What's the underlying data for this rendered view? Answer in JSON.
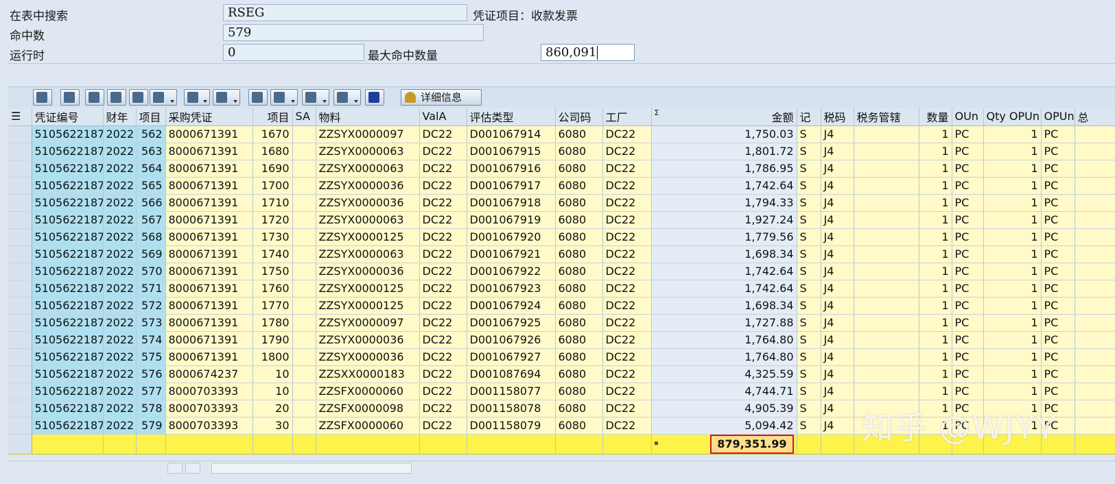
{
  "form": {
    "search_label": "在表中搜索",
    "search_value": "RSEG",
    "search_note": "凭证项目：收款发票",
    "hits_label": "命中数",
    "hits_value": "579",
    "runtime_label": "运行时",
    "runtime_value": "0",
    "max_hits_label": "最大命中数量",
    "max_hits_value": "860,091"
  },
  "toolbar": {
    "detail_label": "详细信息",
    "buttons": [
      "details-icon",
      "print-icon",
      "filter-icon",
      "save-icon",
      "layout-icon",
      "filter-dropdown-icon",
      "sum-icon",
      "subtotal-icon",
      "print-preview-icon",
      "export-icon",
      "spreadsheet-icon",
      "grid-layout-icon",
      "info-icon"
    ]
  },
  "columns": [
    "凭证编号",
    "财年",
    "项目",
    "采购凭证",
    "项目",
    "SA",
    "物料",
    "ValA",
    "评估类型",
    "公司码",
    "工厂",
    "金额",
    "记",
    "税码",
    "税务管辖",
    "数量",
    "OUn",
    "Qty OPUn",
    "OPUn",
    "总"
  ],
  "sum_marker": "Σ",
  "rows": [
    {
      "doc": "5105622187",
      "fy": "2022",
      "item": "562",
      "po": "8000671391",
      "po_item": "1670",
      "mat": "ZZSYX0000097",
      "vala": "DC22",
      "val_type": "D001067914",
      "cc": "6080",
      "plant": "DC22",
      "amt": "1,750.03",
      "dc": "S",
      "tax": "J4",
      "qty": "1",
      "oun": "PC",
      "qty_opun": "1",
      "opun": "PC"
    },
    {
      "doc": "5105622187",
      "fy": "2022",
      "item": "563",
      "po": "8000671391",
      "po_item": "1680",
      "mat": "ZZSYX0000063",
      "vala": "DC22",
      "val_type": "D001067915",
      "cc": "6080",
      "plant": "DC22",
      "amt": "1,801.72",
      "dc": "S",
      "tax": "J4",
      "qty": "1",
      "oun": "PC",
      "qty_opun": "1",
      "opun": "PC"
    },
    {
      "doc": "5105622187",
      "fy": "2022",
      "item": "564",
      "po": "8000671391",
      "po_item": "1690",
      "mat": "ZZSYX0000063",
      "vala": "DC22",
      "val_type": "D001067916",
      "cc": "6080",
      "plant": "DC22",
      "amt": "1,786.95",
      "dc": "S",
      "tax": "J4",
      "qty": "1",
      "oun": "PC",
      "qty_opun": "1",
      "opun": "PC"
    },
    {
      "doc": "5105622187",
      "fy": "2022",
      "item": "565",
      "po": "8000671391",
      "po_item": "1700",
      "mat": "ZZSYX0000036",
      "vala": "DC22",
      "val_type": "D001067917",
      "cc": "6080",
      "plant": "DC22",
      "amt": "1,742.64",
      "dc": "S",
      "tax": "J4",
      "qty": "1",
      "oun": "PC",
      "qty_opun": "1",
      "opun": "PC"
    },
    {
      "doc": "5105622187",
      "fy": "2022",
      "item": "566",
      "po": "8000671391",
      "po_item": "1710",
      "mat": "ZZSYX0000036",
      "vala": "DC22",
      "val_type": "D001067918",
      "cc": "6080",
      "plant": "DC22",
      "amt": "1,794.33",
      "dc": "S",
      "tax": "J4",
      "qty": "1",
      "oun": "PC",
      "qty_opun": "1",
      "opun": "PC"
    },
    {
      "doc": "5105622187",
      "fy": "2022",
      "item": "567",
      "po": "8000671391",
      "po_item": "1720",
      "mat": "ZZSYX0000063",
      "vala": "DC22",
      "val_type": "D001067919",
      "cc": "6080",
      "plant": "DC22",
      "amt": "1,927.24",
      "dc": "S",
      "tax": "J4",
      "qty": "1",
      "oun": "PC",
      "qty_opun": "1",
      "opun": "PC"
    },
    {
      "doc": "5105622187",
      "fy": "2022",
      "item": "568",
      "po": "8000671391",
      "po_item": "1730",
      "mat": "ZZSYX0000125",
      "vala": "DC22",
      "val_type": "D001067920",
      "cc": "6080",
      "plant": "DC22",
      "amt": "1,779.56",
      "dc": "S",
      "tax": "J4",
      "qty": "1",
      "oun": "PC",
      "qty_opun": "1",
      "opun": "PC"
    },
    {
      "doc": "5105622187",
      "fy": "2022",
      "item": "569",
      "po": "8000671391",
      "po_item": "1740",
      "mat": "ZZSYX0000063",
      "vala": "DC22",
      "val_type": "D001067921",
      "cc": "6080",
      "plant": "DC22",
      "amt": "1,698.34",
      "dc": "S",
      "tax": "J4",
      "qty": "1",
      "oun": "PC",
      "qty_opun": "1",
      "opun": "PC"
    },
    {
      "doc": "5105622187",
      "fy": "2022",
      "item": "570",
      "po": "8000671391",
      "po_item": "1750",
      "mat": "ZZSYX0000036",
      "vala": "DC22",
      "val_type": "D001067922",
      "cc": "6080",
      "plant": "DC22",
      "amt": "1,742.64",
      "dc": "S",
      "tax": "J4",
      "qty": "1",
      "oun": "PC",
      "qty_opun": "1",
      "opun": "PC"
    },
    {
      "doc": "5105622187",
      "fy": "2022",
      "item": "571",
      "po": "8000671391",
      "po_item": "1760",
      "mat": "ZZSYX0000125",
      "vala": "DC22",
      "val_type": "D001067923",
      "cc": "6080",
      "plant": "DC22",
      "amt": "1,742.64",
      "dc": "S",
      "tax": "J4",
      "qty": "1",
      "oun": "PC",
      "qty_opun": "1",
      "opun": "PC"
    },
    {
      "doc": "5105622187",
      "fy": "2022",
      "item": "572",
      "po": "8000671391",
      "po_item": "1770",
      "mat": "ZZSYX0000125",
      "vala": "DC22",
      "val_type": "D001067924",
      "cc": "6080",
      "plant": "DC22",
      "amt": "1,698.34",
      "dc": "S",
      "tax": "J4",
      "qty": "1",
      "oun": "PC",
      "qty_opun": "1",
      "opun": "PC"
    },
    {
      "doc": "5105622187",
      "fy": "2022",
      "item": "573",
      "po": "8000671391",
      "po_item": "1780",
      "mat": "ZZSYX0000097",
      "vala": "DC22",
      "val_type": "D001067925",
      "cc": "6080",
      "plant": "DC22",
      "amt": "1,727.88",
      "dc": "S",
      "tax": "J4",
      "qty": "1",
      "oun": "PC",
      "qty_opun": "1",
      "opun": "PC"
    },
    {
      "doc": "5105622187",
      "fy": "2022",
      "item": "574",
      "po": "8000671391",
      "po_item": "1790",
      "mat": "ZZSYX0000036",
      "vala": "DC22",
      "val_type": "D001067926",
      "cc": "6080",
      "plant": "DC22",
      "amt": "1,764.80",
      "dc": "S",
      "tax": "J4",
      "qty": "1",
      "oun": "PC",
      "qty_opun": "1",
      "opun": "PC"
    },
    {
      "doc": "5105622187",
      "fy": "2022",
      "item": "575",
      "po": "8000671391",
      "po_item": "1800",
      "mat": "ZZSYX0000036",
      "vala": "DC22",
      "val_type": "D001067927",
      "cc": "6080",
      "plant": "DC22",
      "amt": "1,764.80",
      "dc": "S",
      "tax": "J4",
      "qty": "1",
      "oun": "PC",
      "qty_opun": "1",
      "opun": "PC"
    },
    {
      "doc": "5105622187",
      "fy": "2022",
      "item": "576",
      "po": "8000674237",
      "po_item": "10",
      "mat": "ZZSXX0000183",
      "vala": "DC22",
      "val_type": "D001087694",
      "cc": "6080",
      "plant": "DC22",
      "amt": "4,325.59",
      "dc": "S",
      "tax": "J4",
      "qty": "1",
      "oun": "PC",
      "qty_opun": "1",
      "opun": "PC"
    },
    {
      "doc": "5105622187",
      "fy": "2022",
      "item": "577",
      "po": "8000703393",
      "po_item": "10",
      "mat": "ZZSFX0000060",
      "vala": "DC22",
      "val_type": "D001158077",
      "cc": "6080",
      "plant": "DC22",
      "amt": "4,744.71",
      "dc": "S",
      "tax": "J4",
      "qty": "1",
      "oun": "PC",
      "qty_opun": "1",
      "opun": "PC"
    },
    {
      "doc": "5105622187",
      "fy": "2022",
      "item": "578",
      "po": "8000703393",
      "po_item": "20",
      "mat": "ZZSFX0000098",
      "vala": "DC22",
      "val_type": "D001158078",
      "cc": "6080",
      "plant": "DC22",
      "amt": "4,905.39",
      "dc": "S",
      "tax": "J4",
      "qty": "1",
      "oun": "PC",
      "qty_opun": "1",
      "opun": "PC"
    },
    {
      "doc": "5105622187",
      "fy": "2022",
      "item": "579",
      "po": "8000703393",
      "po_item": "30",
      "mat": "ZZSFX0000060",
      "vala": "DC22",
      "val_type": "D001158079",
      "cc": "6080",
      "plant": "DC22",
      "amt": "5,094.42",
      "dc": "S",
      "tax": "J4",
      "qty": "1",
      "oun": "PC",
      "qty_opun": "1",
      "opun": "PC"
    }
  ],
  "total": {
    "amount": "879,351.99"
  },
  "watermark": "知乎 @WJYY"
}
